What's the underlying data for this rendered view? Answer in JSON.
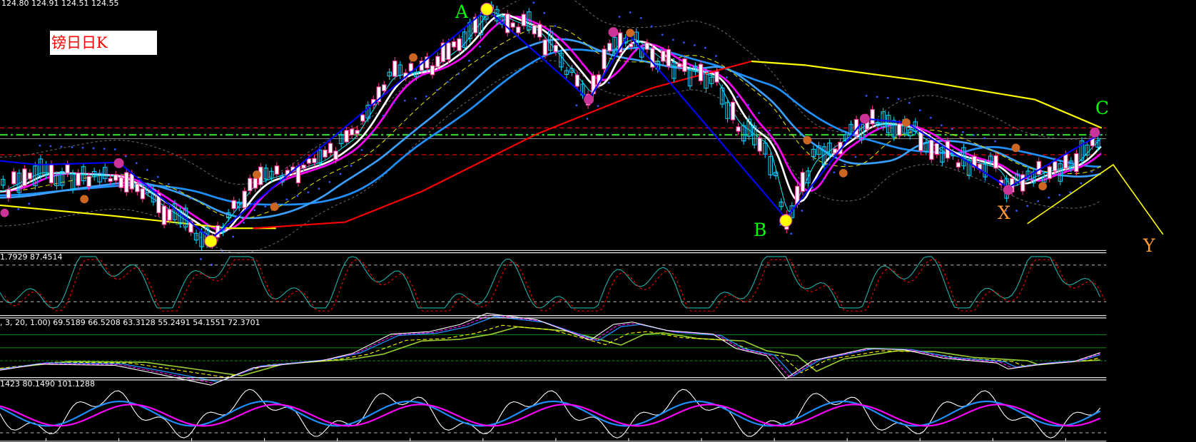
{
  "header": {
    "ohlc": "124.80 124.91 124.51 124.55"
  },
  "title": "镑日日K",
  "wave_labels": {
    "A": "A",
    "B": "B",
    "C": "C",
    "X": "X",
    "Y": "Y"
  },
  "indicators": {
    "stoch_values": "1.7929 87.4514",
    "multi_ma_values": ", 3, 20, 1.00) 69.5189 66.5208 63.3128 55.2491 54.1551 72.3701",
    "osc_values": "1423 80.1490 101.1288"
  },
  "colors": {
    "bg": "#000000",
    "zigzag": "#0000ff",
    "ma_long_up": "#ff0000",
    "ma_long_down": "#ffff00",
    "wave_green": "#00ff00",
    "wave_orange": "#ff9933"
  }
}
